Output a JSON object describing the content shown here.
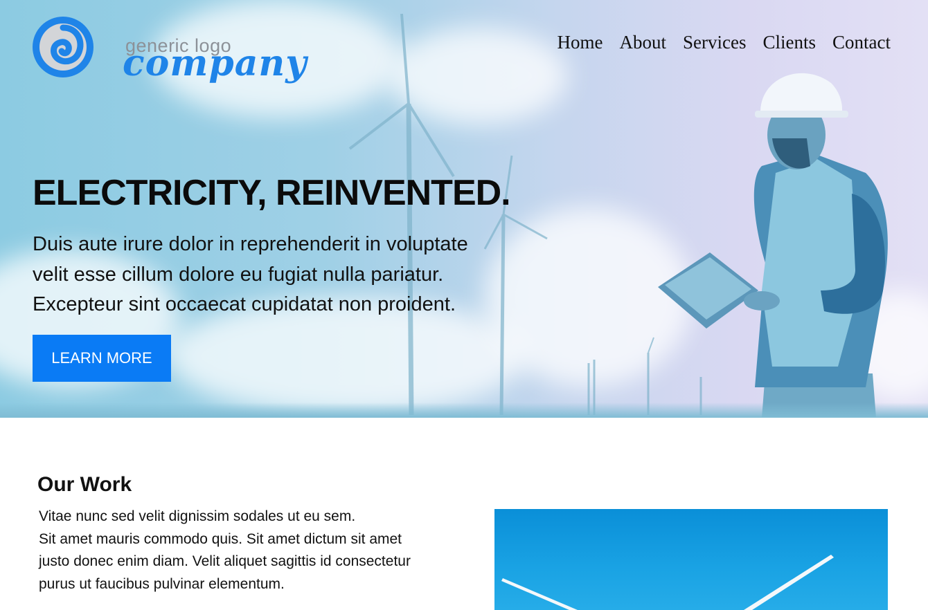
{
  "logo": {
    "small_text": "generic logo",
    "big_text": "company",
    "color_primary": "#1f84e8",
    "color_secondary": "#8c9198"
  },
  "nav": {
    "items": [
      "Home",
      "About",
      "Services",
      "Clients",
      "Contact"
    ]
  },
  "hero": {
    "title": "ELECTRICITY, REINVENTED.",
    "text_lines": [
      "Duis aute irure dolor in reprehenderit in voluptate",
      "velit esse cillum dolore eu fugiat nulla pariatur.",
      "Excepteur sint occaecat cupidatat non proident."
    ],
    "cta_label": "LEARN MORE",
    "cta_color": "#0a7bf5"
  },
  "work": {
    "title": "Our Work",
    "text_lines": [
      "Vitae nunc sed velit dignissim sodales ut eu sem.",
      "Sit amet mauris commodo quis. Sit amet dictum sit amet",
      "justo donec enim diam. Velit aliquet sagittis id consectetur",
      "purus ut faucibus pulvinar elementum."
    ]
  }
}
